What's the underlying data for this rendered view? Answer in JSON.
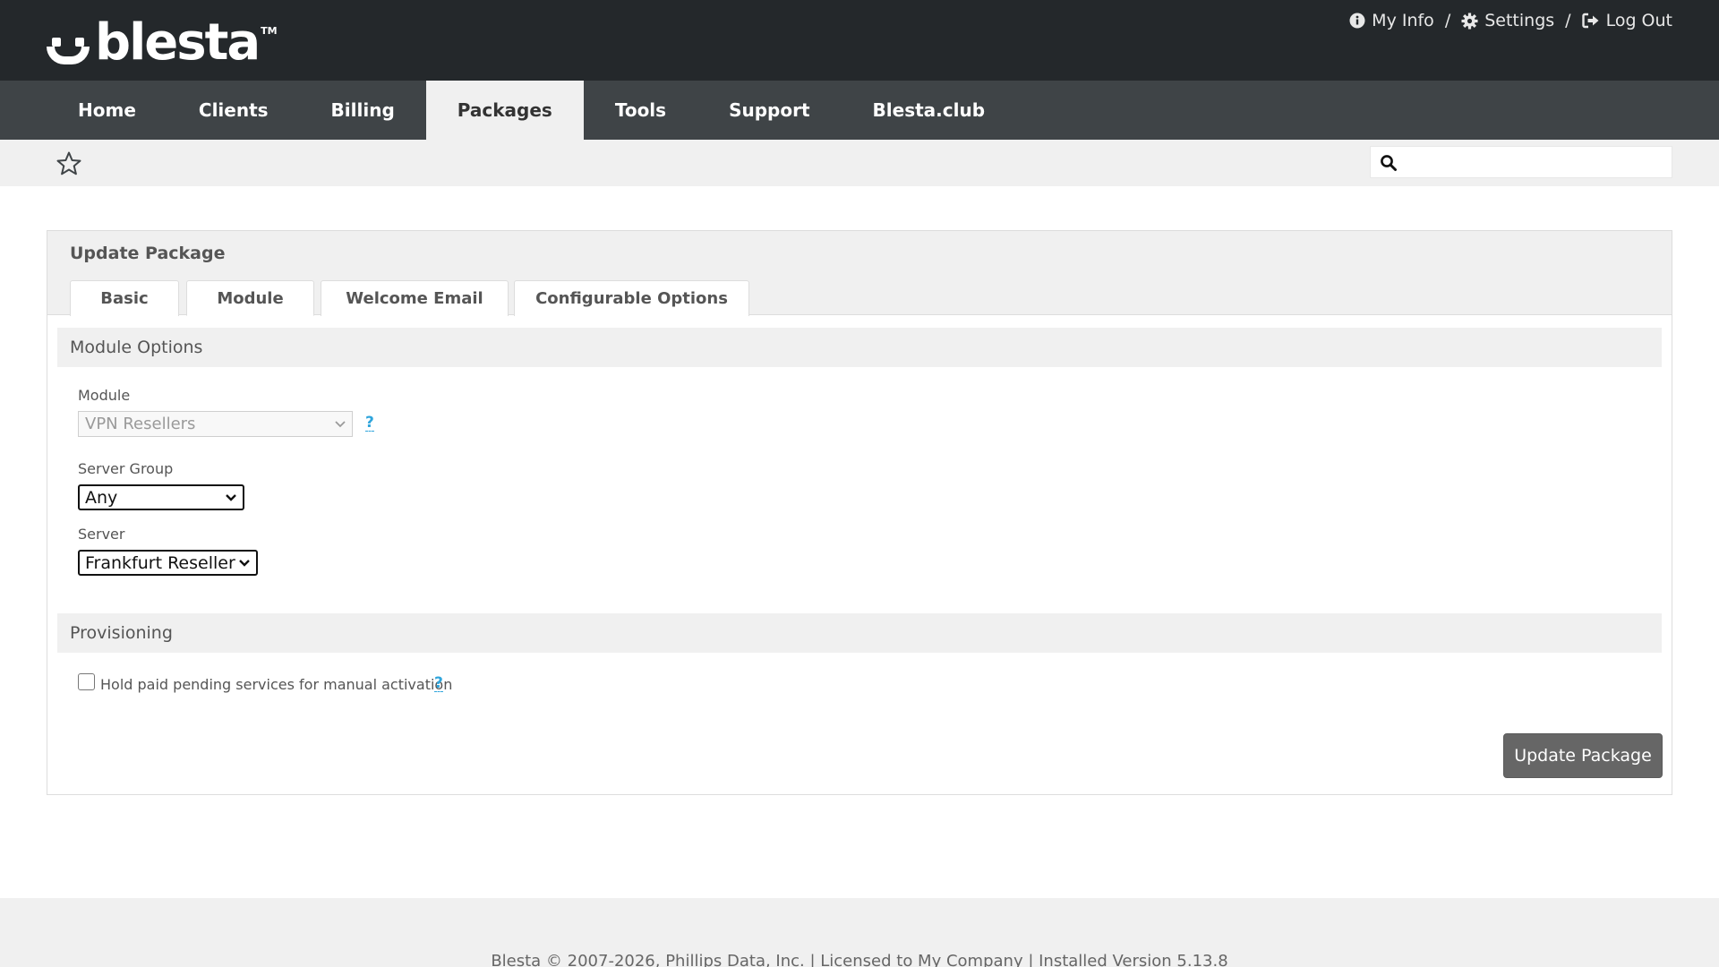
{
  "brand": {
    "name": "blesta",
    "tm": "TM"
  },
  "header": {
    "links": [
      {
        "label": "My Info",
        "icon": "info-circle-icon"
      },
      {
        "label": "Settings",
        "icon": "gear-icon"
      },
      {
        "label": "Log Out",
        "icon": "sign-out-icon"
      }
    ],
    "separator": "/"
  },
  "nav": {
    "items": [
      {
        "label": "Home"
      },
      {
        "label": "Clients"
      },
      {
        "label": "Billing"
      },
      {
        "label": "Packages",
        "active": true
      },
      {
        "label": "Tools"
      },
      {
        "label": "Support"
      },
      {
        "label": "Blesta.club"
      }
    ]
  },
  "search": {
    "value": "",
    "placeholder": ""
  },
  "panel": {
    "title": "Update Package",
    "tabs": [
      {
        "label": "Basic"
      },
      {
        "label": "Module",
        "active": true
      },
      {
        "label": "Welcome Email"
      },
      {
        "label": "Configurable Options"
      }
    ],
    "module_section": {
      "title": "Module Options",
      "module_label": "Module",
      "module_value": "VPN Resellers",
      "help": "?",
      "server_group_label": "Server Group",
      "server_group_value": "Any",
      "server_label": "Server",
      "server_value": "Frankfurt Reseller"
    },
    "provisioning": {
      "title": "Provisioning",
      "hold_label": "Hold paid pending services for manual activation",
      "hold_checked": false,
      "help": "?"
    },
    "submit_label": "Update Package"
  },
  "footer": {
    "text": "Blesta © 2007-2026, Phillips Data, Inc. | Licensed to My Company | Installed Version 5.13.8"
  },
  "colors": {
    "topbar": "#24282b",
    "navbar": "#3f4447",
    "accent_link": "#2fa5dc",
    "button": "#666666"
  }
}
